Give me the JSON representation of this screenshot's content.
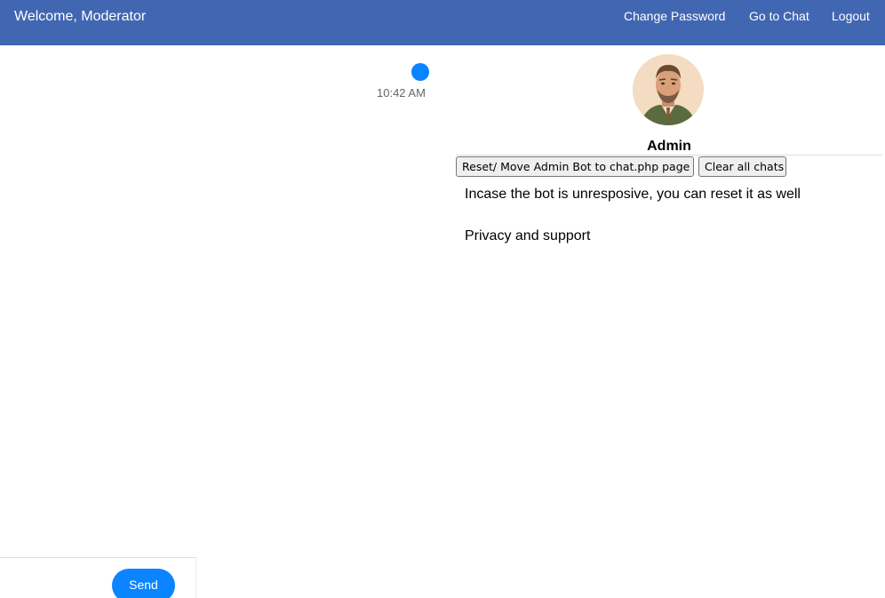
{
  "header": {
    "welcome": "Welcome, Moderator",
    "nav": {
      "change_password": "Change Password",
      "go_to_chat": "Go to Chat",
      "logout": "Logout"
    },
    "bg_color": "#4267b2"
  },
  "chat": {
    "message_time": "10:42 AM",
    "send_label": "Send",
    "accent_color": "#0a84ff"
  },
  "admin_panel": {
    "avatar_icon": "admin-avatar-portrait",
    "name": "Admin",
    "buttons": {
      "reset": "Reset/ Move Admin Bot to chat.php page",
      "clear": "Clear all chats"
    },
    "info": [
      "Incase the bot is unresposive, you can reset it as well",
      "Privacy and support"
    ]
  }
}
